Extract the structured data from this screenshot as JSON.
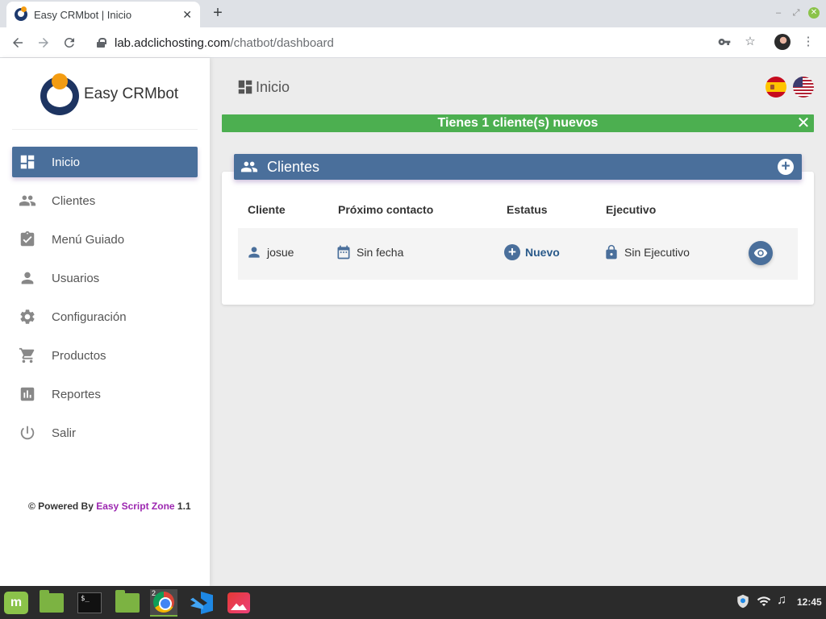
{
  "browser": {
    "tab_title": "Easy CRMbot | Inicio",
    "url_host": "lab.adclichosting.com",
    "url_path": "/chatbot/dashboard"
  },
  "brand": {
    "name": "Easy CRMbot"
  },
  "sidebar": {
    "items": [
      {
        "label": "Inicio",
        "icon": "dashboard-icon",
        "active": true
      },
      {
        "label": "Clientes",
        "icon": "people-icon"
      },
      {
        "label": "Menú Guiado",
        "icon": "clipboard-check-icon"
      },
      {
        "label": "Usuarios",
        "icon": "person-icon"
      },
      {
        "label": "Configuración",
        "icon": "gear-icon"
      },
      {
        "label": "Productos",
        "icon": "cart-icon"
      },
      {
        "label": "Reportes",
        "icon": "bar-chart-icon"
      },
      {
        "label": "Salir",
        "icon": "power-icon"
      }
    ],
    "footer": {
      "prefix": "© Powered By ",
      "link": "Easy Script Zone",
      "version": " 1.1"
    }
  },
  "header": {
    "title": "Inicio"
  },
  "alert": {
    "message": "Tienes 1 cliente(s) nuevos",
    "close": "✕"
  },
  "clients_card": {
    "title": "Clientes",
    "add_label": "+",
    "columns": [
      "Cliente",
      "Próximo contacto",
      "Estatus",
      "Ejecutivo"
    ],
    "rows": [
      {
        "cliente": "josue",
        "proximo_contacto": "Sin fecha",
        "estatus": "Nuevo",
        "ejecutivo": "Sin Ejecutivo"
      }
    ]
  },
  "taskbar": {
    "chrome_badge": "2",
    "terminal_prompt": "$_",
    "time": "12:45"
  },
  "colors": {
    "accent": "#4a6f9b",
    "success": "#4caf50",
    "link": "#9c27b0",
    "logo_orange": "#f39c12"
  }
}
